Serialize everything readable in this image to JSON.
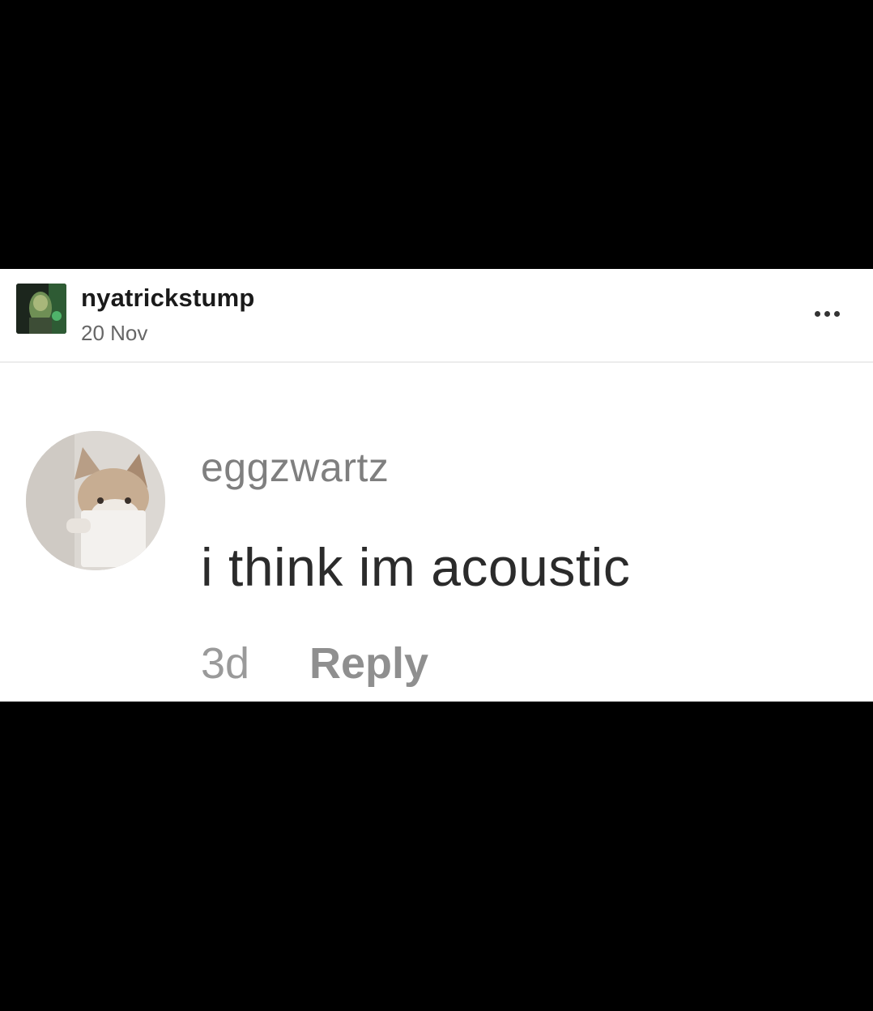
{
  "post": {
    "author": "nyatrickstump",
    "date": "20 Nov",
    "more_icon": "ellipsis-icon"
  },
  "comment": {
    "username": "eggzwartz",
    "text": "i think im acoustic",
    "time": "3d",
    "reply_label": "Reply"
  },
  "colors": {
    "background": "#000000",
    "card": "#ffffff",
    "username_gray": "#7f7f7f",
    "text_dark": "#2b2b2b"
  }
}
